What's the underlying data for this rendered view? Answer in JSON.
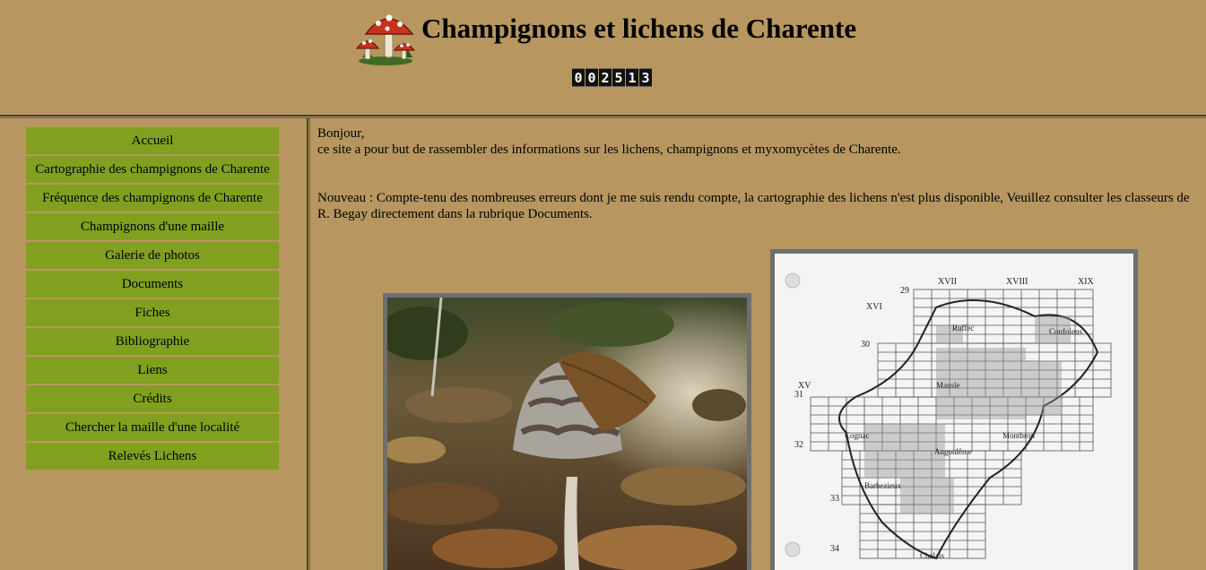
{
  "header": {
    "title": "Champignons et lichens de Charente",
    "counter_digits": [
      "0",
      "0",
      "2",
      "5",
      "1",
      "3"
    ]
  },
  "nav": {
    "items": [
      {
        "label": "Accueil"
      },
      {
        "label": "Cartographie des champignons de Charente"
      },
      {
        "label": "Fréquence des champignons de Charente"
      },
      {
        "label": "Champignons d'une maille"
      },
      {
        "label": "Galerie de photos"
      },
      {
        "label": "Documents"
      },
      {
        "label": "Fiches"
      },
      {
        "label": "Bibliographie"
      },
      {
        "label": "Liens"
      },
      {
        "label": "Crédits"
      },
      {
        "label": "Chercher la maille d'une localité"
      },
      {
        "label": "Relevés Lichens"
      }
    ]
  },
  "main": {
    "greeting": "Bonjour,",
    "intro": "ce site a pour but de rassembler des informations sur les lichens, champignons et myxomycètes de Charente.",
    "news": "Nouveau : Compte-tenu des nombreuses erreurs dont je me suis rendu compte, la cartographie des lichens n'est plus disponible, Veuillez consulter les classeurs de R. Begay directement dans la rubrique Documents."
  },
  "map": {
    "col_labels": [
      "XV",
      "XVI",
      "XVII",
      "XVIII",
      "XIX"
    ],
    "row_labels": [
      "29",
      "30",
      "31",
      "32",
      "33",
      "34"
    ],
    "places": [
      "Ruffec",
      "Confolens",
      "Mansle",
      "Cognac",
      "Montbron",
      "Angoulême",
      "Barbezieux",
      "Chalais"
    ]
  },
  "colors": {
    "background": "#b7975f",
    "nav_button": "#82a020",
    "photo_frame": "#6f6f6f"
  }
}
